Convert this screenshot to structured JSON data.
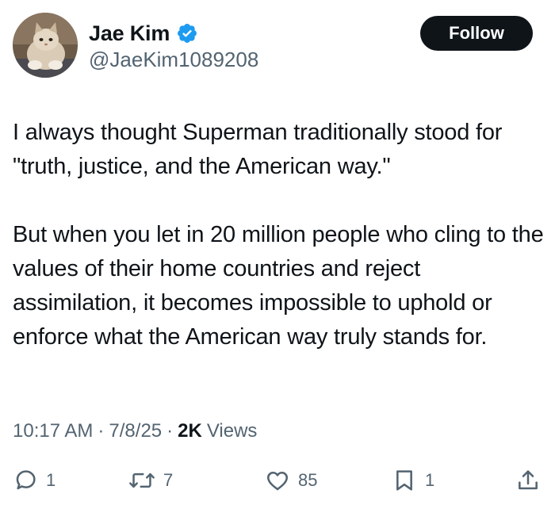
{
  "header": {
    "display_name": "Jae Kim",
    "handle": "@JaeKim1089208",
    "follow_label": "Follow",
    "verified_icon": "verified-badge-icon",
    "accent_color": "#1d9bf0"
  },
  "body": {
    "paragraph_1": "I always thought Superman traditionally stood for \"truth, justice, and the American way.\"",
    "paragraph_2": "But when you let in 20 million people who cling to the values of their home countries and reject assimilation, it becomes impossible to uphold or enforce what the American way truly stands for."
  },
  "meta": {
    "time": "10:17 AM",
    "date": "7/8/25",
    "separator": "·",
    "views_count": "2K",
    "views_label": "Views"
  },
  "actions": {
    "reply_count": "1",
    "retweet_count": "7",
    "like_count": "85",
    "bookmark_count": "1"
  }
}
